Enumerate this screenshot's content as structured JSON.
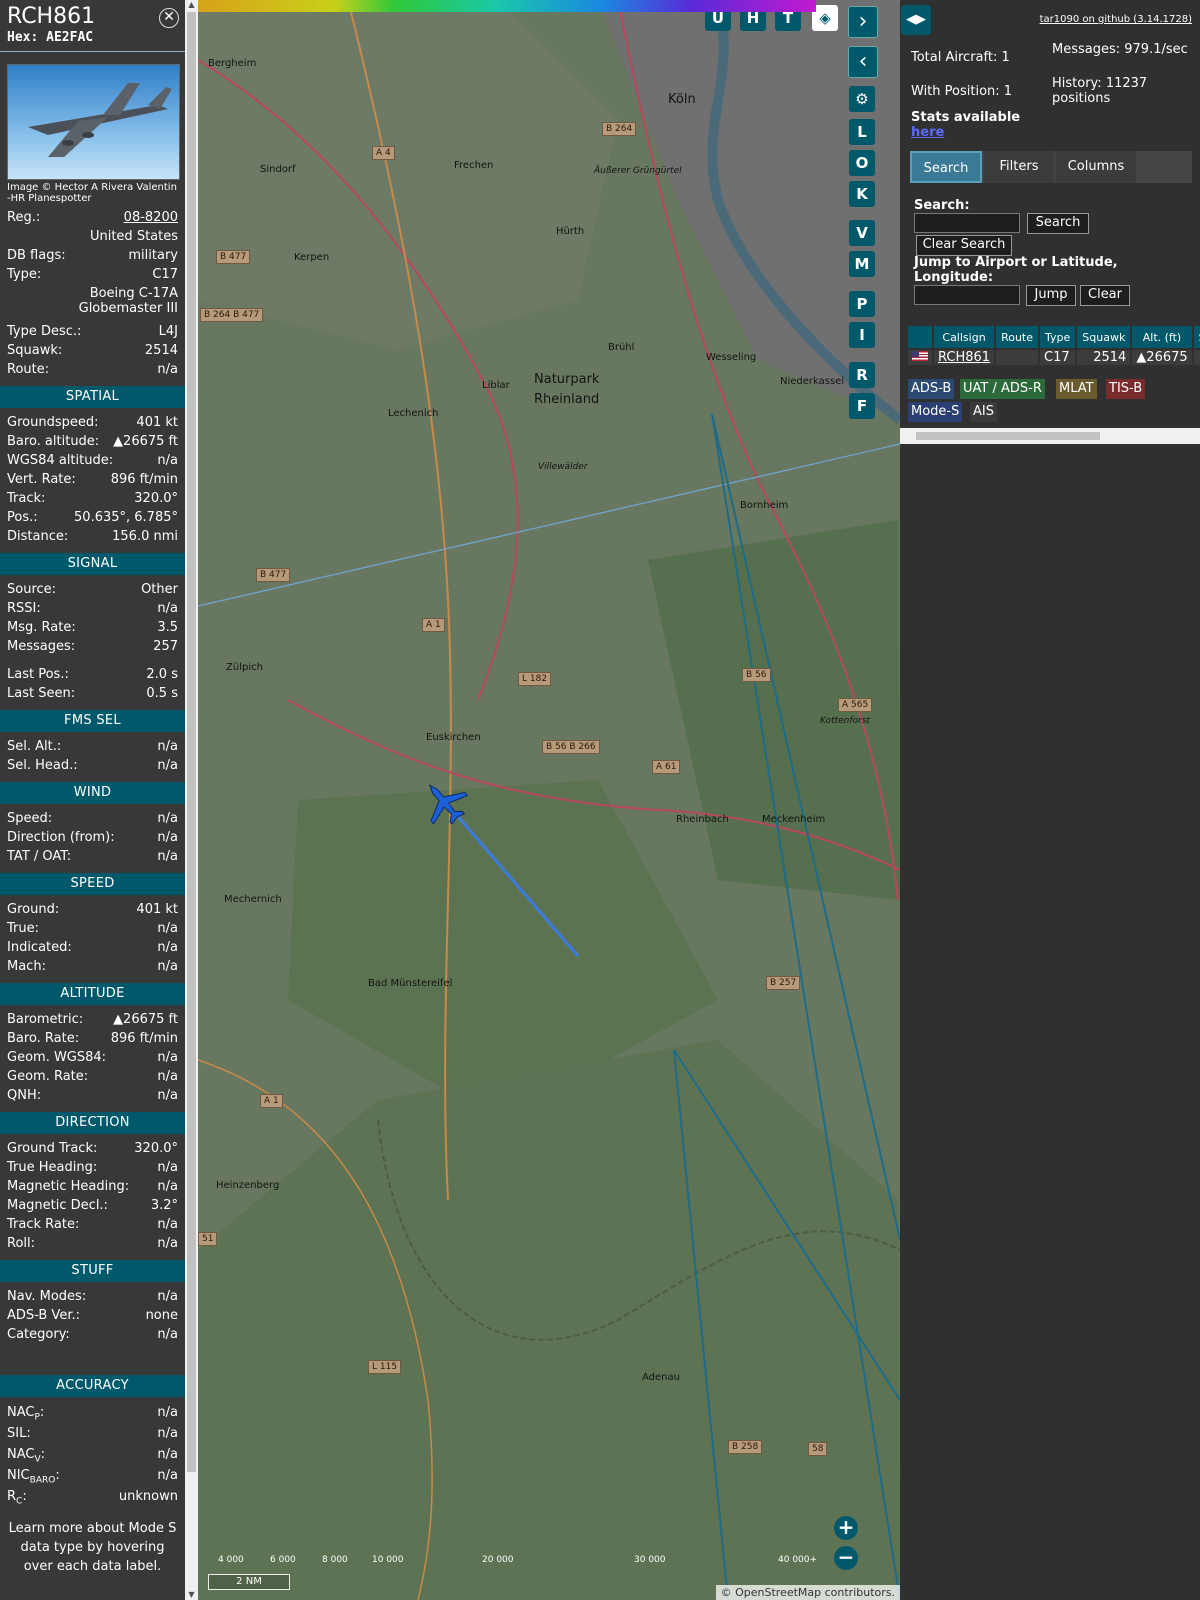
{
  "aircraft": {
    "callsign": "RCH861",
    "hex_label": "Hex:",
    "hex": "AE2FAC",
    "photo_credit": "Image © Hector A Rivera Valentin -HR Planespotter",
    "reg_label": "Reg.:",
    "reg": "08-8200",
    "country": "United States",
    "dbflags_label": "DB flags:",
    "dbflags": "military",
    "type_label": "Type:",
    "type": "C17",
    "model": "Boeing C-17A Globemaster III",
    "typedesc_label": "Type Desc.:",
    "typedesc": "L4J",
    "squawk_label": "Squawk:",
    "squawk": "2514",
    "route_label": "Route:",
    "route": "n/a"
  },
  "spatial": {
    "title": "SPATIAL",
    "rows": [
      [
        "Groundspeed:",
        "401 kt"
      ],
      [
        "Baro. altitude:",
        "▲26675 ft"
      ],
      [
        "WGS84 altitude:",
        "n/a"
      ],
      [
        "Vert. Rate:",
        "896 ft/min"
      ],
      [
        "Track:",
        "320.0°"
      ],
      [
        "Pos.:",
        "50.635°, 6.785°"
      ],
      [
        "Distance:",
        "156.0 nmi"
      ]
    ]
  },
  "signal": {
    "title": "SIGNAL",
    "rows": [
      [
        "Source:",
        "Other"
      ],
      [
        "RSSI:",
        "n/a"
      ],
      [
        "Msg. Rate:",
        "3.5"
      ],
      [
        "Messages:",
        "257"
      ]
    ],
    "rows2": [
      [
        "Last Pos.:",
        "2.0 s"
      ],
      [
        "Last Seen:",
        "0.5 s"
      ]
    ]
  },
  "fmssel": {
    "title": "FMS SEL",
    "rows": [
      [
        "Sel. Alt.:",
        "n/a"
      ],
      [
        "Sel. Head.:",
        "n/a"
      ]
    ]
  },
  "wind": {
    "title": "WIND",
    "rows": [
      [
        "Speed:",
        "n/a"
      ],
      [
        "Direction (from):",
        "n/a"
      ],
      [
        "TAT / OAT:",
        "n/a"
      ]
    ]
  },
  "speed": {
    "title": "SPEED",
    "rows": [
      [
        "Ground:",
        "401 kt"
      ],
      [
        "True:",
        "n/a"
      ],
      [
        "Indicated:",
        "n/a"
      ],
      [
        "Mach:",
        "n/a"
      ]
    ]
  },
  "altitude": {
    "title": "ALTITUDE",
    "rows": [
      [
        "Barometric:",
        "▲26675 ft"
      ],
      [
        "Baro. Rate:",
        "896 ft/min"
      ],
      [
        "Geom. WGS84:",
        "n/a"
      ],
      [
        "Geom. Rate:",
        "n/a"
      ],
      [
        "QNH:",
        "n/a"
      ]
    ]
  },
  "direction": {
    "title": "DIRECTION",
    "rows": [
      [
        "Ground Track:",
        "320.0°"
      ],
      [
        "True Heading:",
        "n/a"
      ],
      [
        "Magnetic Heading:",
        "n/a"
      ],
      [
        "Magnetic Decl.:",
        "3.2°"
      ],
      [
        "Track Rate:",
        "n/a"
      ],
      [
        "Roll:",
        "n/a"
      ]
    ]
  },
  "stuff": {
    "title": "STUFF",
    "rows": [
      [
        "Nav. Modes:",
        "n/a"
      ],
      [
        "ADS-B Ver.:",
        "none"
      ],
      [
        "Category:",
        "n/a"
      ]
    ]
  },
  "accuracy": {
    "title": "ACCURACY",
    "nacp": "NAC",
    "nacp_sub": "P",
    "nacp_val": "n/a",
    "sil": "SIL:",
    "sil_val": "n/a",
    "nacv": "NAC",
    "nacv_sub": "V",
    "nacv_val": "n/a",
    "nicbaro": "NIC",
    "nicbaro_sub": "BARO",
    "nicbaro_val": "n/a",
    "rc": "R",
    "rc_sub": "C",
    "rc_val": "unknown"
  },
  "footer_note": "Learn more about Mode S data type by hovering over each data label.",
  "map": {
    "buttons_top": [
      "U",
      "H",
      "T"
    ],
    "buttons_side": [
      "L",
      "O",
      "K",
      "V",
      "M",
      "P",
      "I",
      "R",
      "F"
    ],
    "places": [
      {
        "name": "Köln"
      },
      {
        "name": "Bergheim"
      },
      {
        "name": "Frechen"
      },
      {
        "name": "Sindorf"
      },
      {
        "name": "Kerpen"
      },
      {
        "name": "Hürth"
      },
      {
        "name": "Brühl"
      },
      {
        "name": "Wesseling"
      },
      {
        "name": "Niederkassel"
      },
      {
        "name": "Liblar"
      },
      {
        "name": "Lechenich"
      },
      {
        "name": "Naturpark"
      },
      {
        "name": "Rheinland"
      },
      {
        "name": "Bornheim"
      },
      {
        "name": "Zülpich"
      },
      {
        "name": "Euskirchen"
      },
      {
        "name": "Rheinbach"
      },
      {
        "name": "Meckenheim"
      },
      {
        "name": "Mechernich"
      },
      {
        "name": "Bad Münstereifel"
      },
      {
        "name": "Heinzenberg"
      },
      {
        "name": "Adenau"
      },
      {
        "name": "Äußerer Grüngürtel"
      },
      {
        "name": "Villewälder"
      },
      {
        "name": "Kottenforst"
      }
    ],
    "roads": [
      "B 264",
      "A 4",
      "B 477",
      "B 264 B 477",
      "B 477",
      "A 1",
      "L 182",
      "B 56",
      "B 56 B 266",
      "A 61",
      "A 565",
      "B 257",
      "A 1",
      "L 115",
      "B 258",
      "51",
      "58"
    ],
    "alt_ticks": [
      "4 000",
      "6 000",
      "8 000",
      "10 000",
      "20 000",
      "30 000",
      "40 000+"
    ],
    "scale": "2 NM",
    "attribution": "© OpenStreetMap contributors.",
    "zoom_in": "+",
    "zoom_out": "−"
  },
  "side": {
    "version_link": "tar1090 on github (3.14.1728)",
    "total_aircraft": "Total Aircraft: 1",
    "with_position": "With Position: 1",
    "messages": "Messages: 979.1/sec",
    "history": "History: 11237 positions",
    "stats_text": "Stats available",
    "stats_link": "here",
    "tabs": [
      "Search",
      "Filters",
      "Columns"
    ],
    "search_label": "Search:",
    "search_btn": "Search",
    "clear_search_btn": "Clear Search",
    "jump_label": "Jump to Airport or Latitude, Longitude:",
    "jump_btn": "Jump",
    "clear_btn": "Clear",
    "table_headers": [
      "",
      "Callsign",
      "Route",
      "Type",
      "Squawk",
      "Alt. (ft)",
      "Spd"
    ],
    "table_rows": [
      [
        "",
        "RCH861",
        "",
        "C17",
        "2514",
        "▲26675",
        ""
      ]
    ],
    "badges": [
      "ADS-B",
      "UAT / ADS-R",
      "MLAT",
      "TIS-B",
      "Mode-S",
      "AIS"
    ]
  },
  "colors": {
    "accent": "#00596b",
    "panel": "#383838",
    "adsb": "#2b4a72",
    "uat": "#2d6a3a",
    "mlat": "#6a5b2f",
    "tisb": "#7a2c2c",
    "modes": "#2b3f72"
  }
}
